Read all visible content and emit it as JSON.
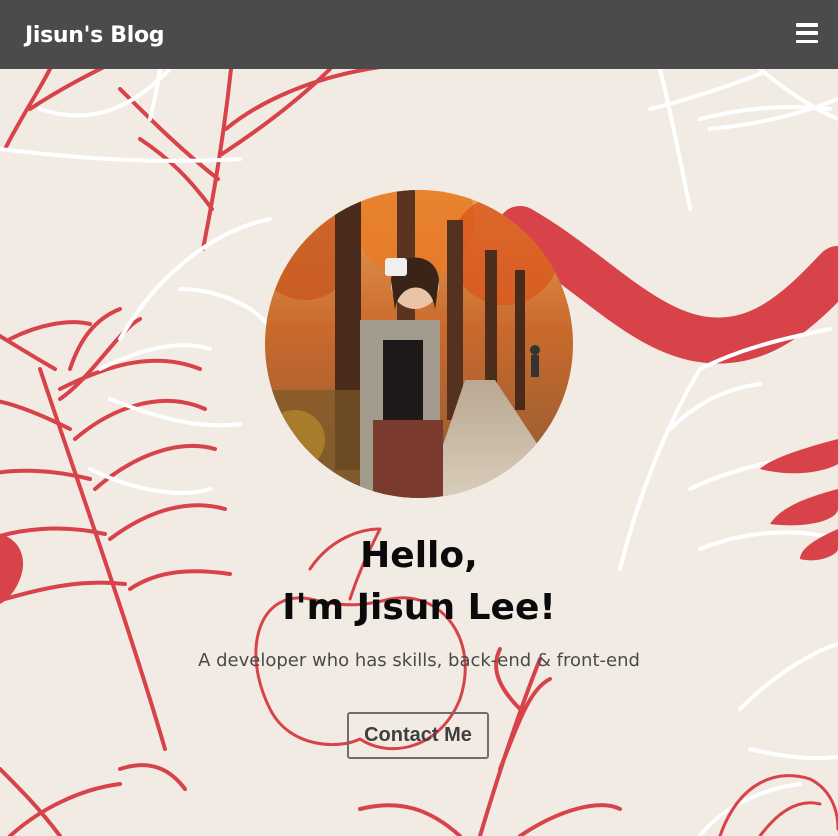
{
  "navbar": {
    "brand": "Jisun's Blog",
    "menu_icon": "hamburger-menu-icon"
  },
  "hero": {
    "title_line1": "Hello,",
    "title_line2": "I'm Jisun Lee!",
    "subtitle": "A developer who has skills, back-end & front-end",
    "contact_button": "Contact Me"
  },
  "colors": {
    "navbar": "#4b4b4b",
    "background": "#f1ebe4",
    "accent_red": "#d8434a",
    "text": "#0a0a0a"
  }
}
